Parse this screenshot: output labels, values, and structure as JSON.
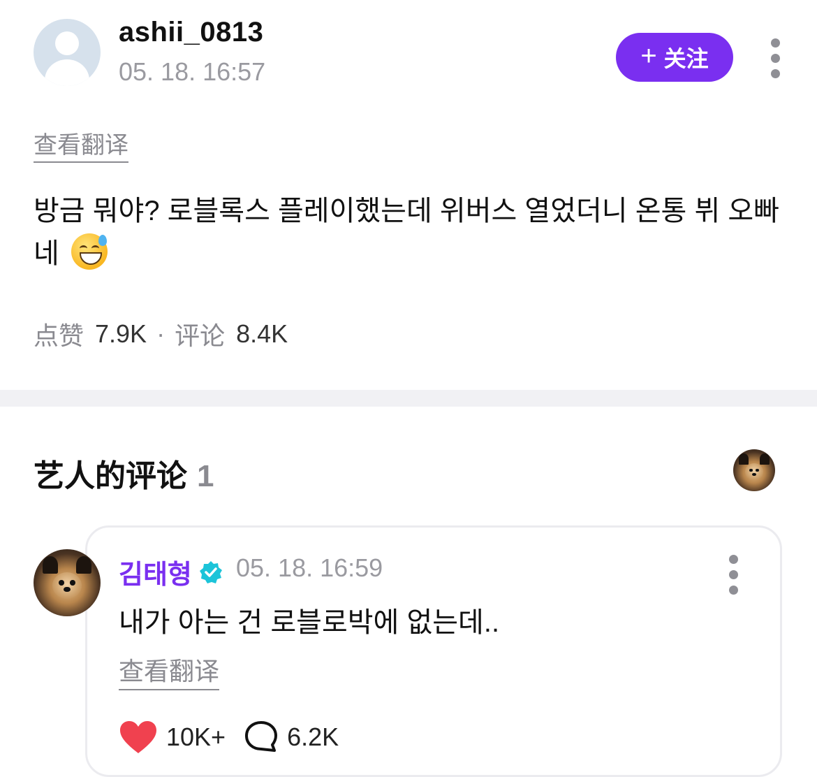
{
  "post": {
    "username": "ashii_0813",
    "time": "05. 18. 16:57",
    "follow_label": "关注",
    "translate_label": "查看翻译",
    "text": "방금 뭐야? 로블록스 플레이했는데 위버스 열었더니 온통 뷔 오빠네",
    "emoji": "grinning-face-with-sweat",
    "stats": {
      "likes_label": "点赞",
      "likes": "7.9K",
      "separator": "·",
      "comments_label": "评论",
      "comments": "8.4K"
    }
  },
  "artist_comments": {
    "title": "艺人的评论",
    "count": "1"
  },
  "comment": {
    "author": "김태형",
    "verified": true,
    "time": "05. 18. 16:59",
    "text": "내가 아는 건 로블로박에 없는데..",
    "translate_label": "查看翻译",
    "likes": "10K+",
    "replies": "6.2K"
  },
  "colors": {
    "accent": "#7a2ff0",
    "muted": "#9a9aa0",
    "heart": "#f0414f",
    "verified": "#1cc4d9"
  },
  "icons": [
    "person-avatar-icon",
    "plus-icon",
    "more-vertical-icon",
    "heart-icon",
    "comment-bubble-icon",
    "verified-badge-icon"
  ]
}
